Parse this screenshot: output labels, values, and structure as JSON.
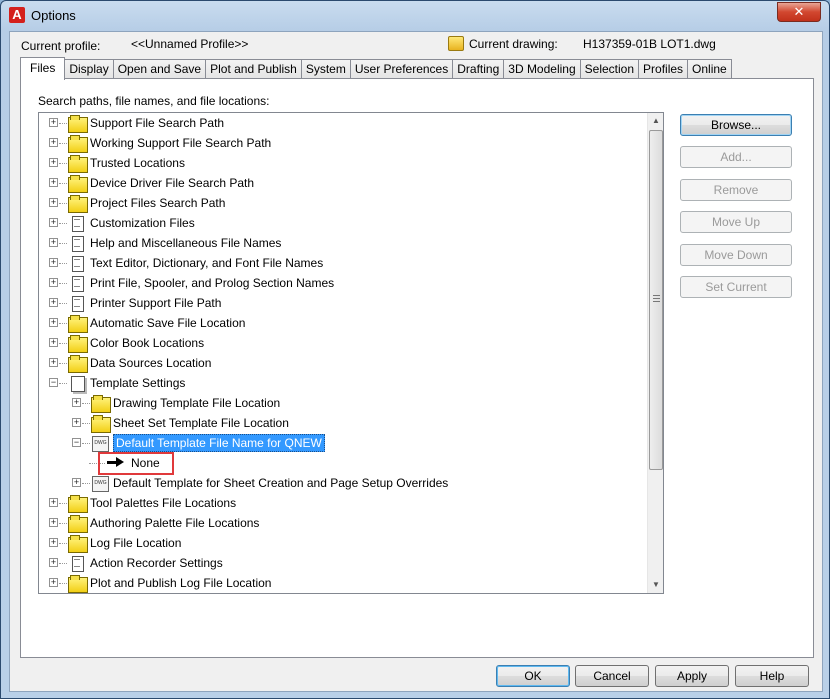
{
  "window": {
    "title": "Options",
    "app_icon": "autocad-logo-icon",
    "close_glyph": "✕"
  },
  "header": {
    "profile_label": "Current profile:",
    "profile_value": "<<Unnamed Profile>>",
    "drawing_label": "Current drawing:",
    "drawing_value": "H137359-01B LOT1.dwg"
  },
  "tabs": [
    "Files",
    "Display",
    "Open and Save",
    "Plot and Publish",
    "System",
    "User Preferences",
    "Drafting",
    "3D Modeling",
    "Selection",
    "Profiles",
    "Online"
  ],
  "active_tab": "Files",
  "files": {
    "section_label": "Search paths, file names, and file locations:",
    "tree": [
      {
        "label": "Support File Search Path",
        "icon": "folder-icon",
        "expander": "+"
      },
      {
        "label": "Working Support File Search Path",
        "icon": "folder-icon",
        "expander": "+"
      },
      {
        "label": "Trusted Locations",
        "icon": "folder-icon",
        "expander": "+"
      },
      {
        "label": "Device Driver File Search Path",
        "icon": "folder-icon",
        "expander": "+"
      },
      {
        "label": "Project Files Search Path",
        "icon": "project-icon",
        "expander": "+"
      },
      {
        "label": "Customization Files",
        "icon": "document-icon",
        "expander": "+"
      },
      {
        "label": "Help and Miscellaneous File Names",
        "icon": "document-icon",
        "expander": "+"
      },
      {
        "label": "Text Editor, Dictionary, and Font File Names",
        "icon": "document-icon",
        "expander": "+"
      },
      {
        "label": "Print File, Spooler, and Prolog Section Names",
        "icon": "document-icon",
        "expander": "+"
      },
      {
        "label": "Printer Support File Path",
        "icon": "document-icon",
        "expander": "+"
      },
      {
        "label": "Automatic Save File Location",
        "icon": "folder-icon",
        "expander": "+"
      },
      {
        "label": "Color Book Locations",
        "icon": "folder-icon",
        "expander": "+"
      },
      {
        "label": "Data Sources Location",
        "icon": "folder-icon",
        "expander": "+"
      },
      {
        "label": "Template Settings",
        "icon": "template-icon",
        "expander": "−"
      },
      {
        "label": "Drawing Template File Location",
        "icon": "folder-icon",
        "expander": "+",
        "indent": 1
      },
      {
        "label": "Sheet Set Template File Location",
        "icon": "folder-icon",
        "expander": "+",
        "indent": 1
      },
      {
        "label": "Default Template File Name for QNEW",
        "icon": "dwg-file-icon",
        "expander": "−",
        "indent": 1,
        "selected": true
      },
      {
        "label": "None",
        "icon": "arrow-right-icon",
        "expander": "",
        "indent": 2
      },
      {
        "label": "Default Template for Sheet Creation and Page Setup Overrides",
        "icon": "dwg-file-icon",
        "expander": "+",
        "indent": 1
      },
      {
        "label": "Tool Palettes File Locations",
        "icon": "folder-icon",
        "expander": "+"
      },
      {
        "label": "Authoring Palette File Locations",
        "icon": "folder-icon",
        "expander": "+"
      },
      {
        "label": "Log File Location",
        "icon": "folder-icon",
        "expander": "+"
      },
      {
        "label": "Action Recorder Settings",
        "icon": "document-icon",
        "expander": "+"
      },
      {
        "label": "Plot and Publish Log File Location",
        "icon": "folder-icon",
        "expander": "+"
      }
    ],
    "highlight_color": "#e0393b",
    "selection_color": "#3399ff"
  },
  "side_buttons": {
    "browse": "Browse...",
    "add": "Add...",
    "remove": "Remove",
    "move_up": "Move Up",
    "move_down": "Move Down",
    "set_current": "Set Current"
  },
  "footer": {
    "ok": "OK",
    "cancel": "Cancel",
    "apply": "Apply",
    "help": "Help"
  },
  "scrollbar": {
    "up_glyph": "▲",
    "down_glyph": "▼"
  }
}
